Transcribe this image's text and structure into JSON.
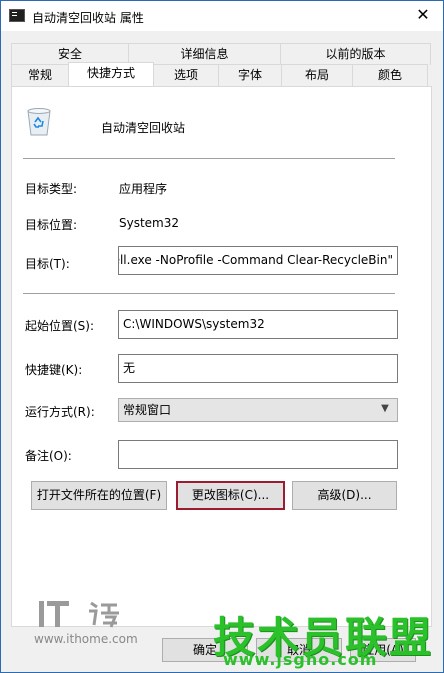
{
  "window": {
    "title": "自动清空回收站 属性",
    "close_glyph": "✕"
  },
  "tabs_top": [
    "安全",
    "详细信息",
    "以前的版本"
  ],
  "tabs_bottom": [
    "常规",
    "快捷方式",
    "选项",
    "字体",
    "布局",
    "颜色"
  ],
  "active_tab": "快捷方式",
  "shortcut": {
    "name": "自动清空回收站",
    "target_type_label": "目标类型:",
    "target_type_value": "应用程序",
    "target_location_label": "目标位置:",
    "target_location_value": "System32",
    "target_label": "目标(T):",
    "target_value": "ell.exe -NoProfile -Command Clear-RecycleBin\"",
    "start_in_label": "起始位置(S):",
    "start_in_value": "C:\\WINDOWS\\system32",
    "hotkey_label": "快捷键(K):",
    "hotkey_value": "无",
    "run_label": "运行方式(R):",
    "run_value": "常规窗口",
    "comment_label": "备注(O):",
    "comment_value": ""
  },
  "buttons": {
    "open_location": "打开文件所在的位置(F)",
    "change_icon": "更改图标(C)...",
    "advanced": "高级(D)...",
    "ok": "确定",
    "cancel": "取消",
    "apply": "应用(A)"
  },
  "watermark": {
    "ithome_url": "www.ithome.com",
    "big_text": "技术员联盟",
    "site_url": "www.jsgho.com"
  },
  "colors": {
    "focus_border": "#9b1b2f",
    "accent": "#2b6cb0",
    "watermark_green": "#2bc12b"
  }
}
